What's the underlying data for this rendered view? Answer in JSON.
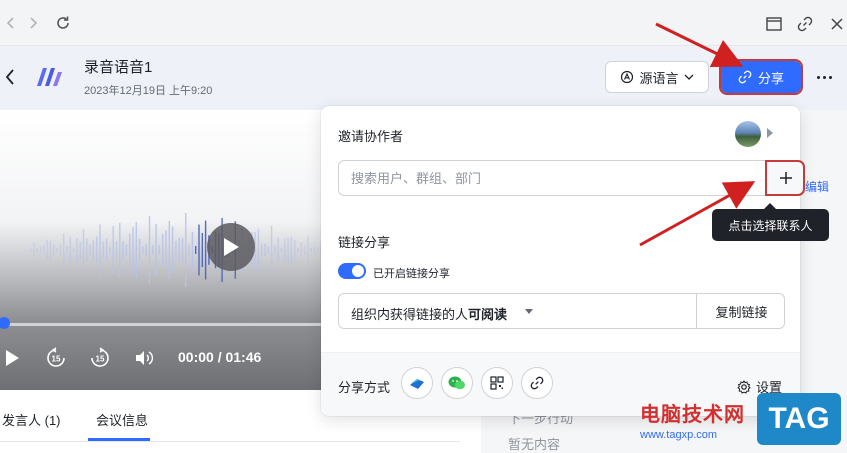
{
  "header": {
    "title": "录音语音1",
    "date": "2023年12月19日 上午9:20",
    "language_button": "源语言",
    "share_button": "分享"
  },
  "player": {
    "time": "00:00 / 01:46",
    "progress": 0
  },
  "tabs": [
    {
      "label": "发言人 (1)"
    },
    {
      "label": "会议信息"
    }
  ],
  "right_panel": {
    "edit": "编辑",
    "next_step": "下一步行动",
    "no_content": "暂无内容"
  },
  "share_panel": {
    "invite_title": "邀请协作者",
    "search_placeholder": "搜索用户、群组、部门",
    "link_share_title": "链接分享",
    "link_share_enabled_label": "已开启链接分享",
    "link_share_enabled": true,
    "permission_prefix": "组织内获得链接的人",
    "permission_level": "可阅读",
    "copy_link": "复制链接",
    "share_methods_label": "分享方式",
    "settings_label": "设置"
  },
  "tooltip": "点击选择联系人",
  "watermark": {
    "site_name": "电脑技术网",
    "url": "www.tagxp.com",
    "tag": "TAG"
  },
  "colors": {
    "accent": "#2f6bff",
    "annotation_arrow": "#d02020"
  }
}
